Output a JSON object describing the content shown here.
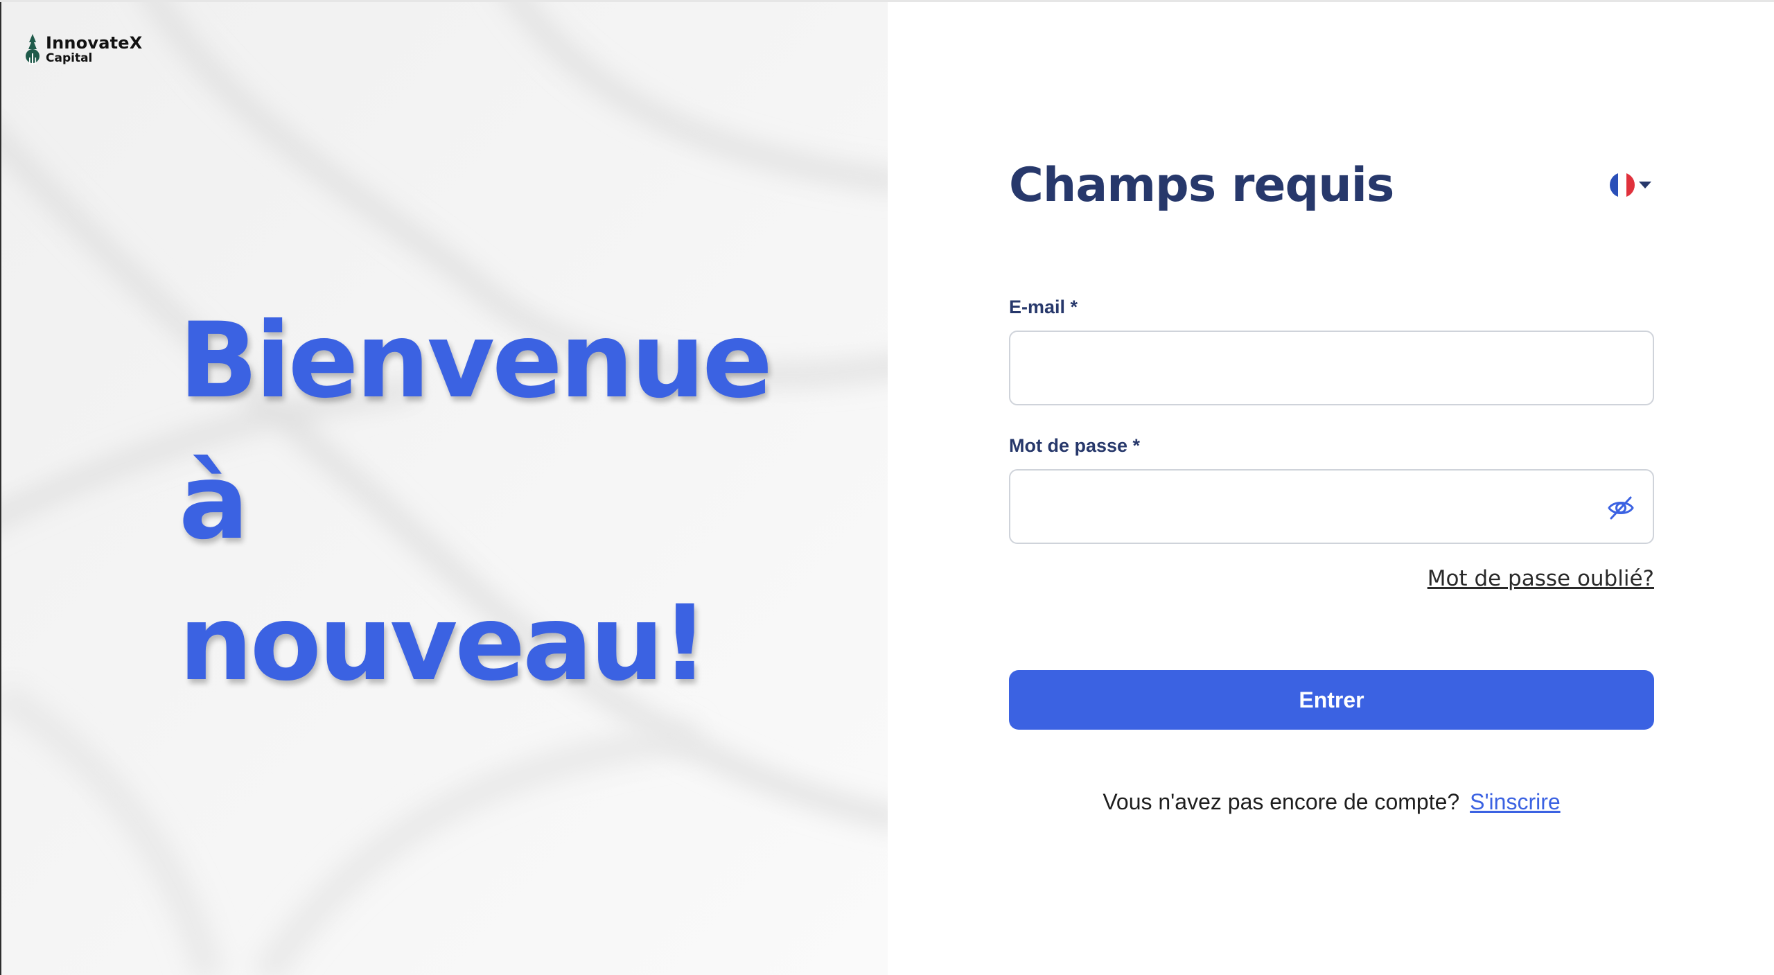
{
  "brand": {
    "name": "InnovateX",
    "sub": "Capital",
    "logo_icon": "tree-icon",
    "logo_color": "#1f5a4a"
  },
  "hero": {
    "line1": "Bienvenue",
    "line2": "à",
    "line3": "nouveau!",
    "color": "#3b62e2"
  },
  "form": {
    "title": "Champs requis",
    "language": {
      "selected": "fr",
      "icon": "france-flag-icon"
    },
    "email": {
      "label": "E-mail *",
      "value": "",
      "placeholder": ""
    },
    "password": {
      "label": "Mot de passe *",
      "value": "",
      "placeholder": "",
      "toggle_icon": "eye-slash-icon"
    },
    "forgot_label": "Mot de passe oublié?",
    "submit_label": "Entrer",
    "signup_prompt": "Vous n'avez pas encore de compte?",
    "signup_link": "S'inscrire"
  },
  "colors": {
    "accent": "#3b62e2",
    "heading": "#27386b",
    "left_bg": "#f4f4f4"
  }
}
